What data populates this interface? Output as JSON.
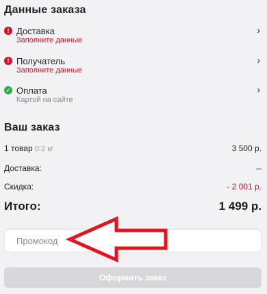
{
  "order_data": {
    "title": "Данные заказа",
    "items": [
      {
        "title": "Доставка",
        "subtitle": "Заполните данные",
        "status": "error",
        "icon": "exclamation-icon"
      },
      {
        "title": "Получатель",
        "subtitle": "Заполните данные",
        "status": "error",
        "icon": "exclamation-icon"
      },
      {
        "title": "Оплата",
        "subtitle": "Картой на сайте",
        "status": "ok",
        "icon": "check-icon"
      }
    ]
  },
  "your_order": {
    "title": "Ваш заказ",
    "goods_label": "1 товар",
    "goods_weight": "0.2 кг",
    "goods_value": "3 500 р.",
    "delivery_label": "Доставка:",
    "delivery_value": "--",
    "discount_label": "Скидка:",
    "discount_value": "- 2 001 р.",
    "total_label": "Итого:",
    "total_value": "1 499 р."
  },
  "promo": {
    "placeholder": "Промокод"
  },
  "submit_label": "Оформить заказ",
  "colors": {
    "error": "#d0132d",
    "ok": "#2bab4c",
    "arrow": "#e3141f",
    "button_disabled": "#d7d7d9",
    "background": "#f2f2f4"
  }
}
